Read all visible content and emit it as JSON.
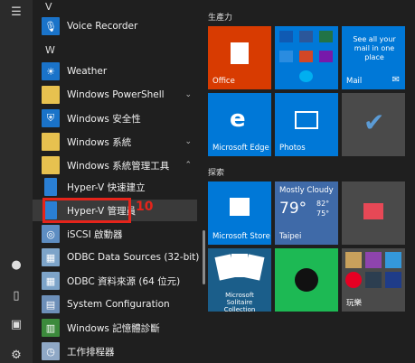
{
  "headers": {
    "v": "V",
    "w": "W"
  },
  "apps": [
    {
      "label": "Voice Recorder",
      "icon": "microphone-icon",
      "color": "#1a73c9"
    },
    {
      "label": "Weather",
      "icon": "sun-icon",
      "color": "#1a73c9"
    },
    {
      "label": "Windows PowerShell",
      "icon": "folder-icon",
      "color": "#e7c14f",
      "chevron": "⌄"
    },
    {
      "label": "Windows 安全性",
      "icon": "shield-icon",
      "color": "#1a73c9"
    },
    {
      "label": "Windows 系統",
      "icon": "folder-icon",
      "color": "#e7c14f",
      "chevron": "⌄"
    },
    {
      "label": "Windows 系統管理工具",
      "icon": "folder-icon",
      "color": "#e7c14f",
      "chevron": "⌃"
    },
    {
      "label": "Hyper-V 快速建立",
      "icon": "hyperv-icon",
      "color": "transparent"
    },
    {
      "label": "Hyper-V 管理員",
      "icon": "hyperv-icon",
      "color": "transparent"
    },
    {
      "label": "iSCSI 啟動器",
      "icon": "iscsi-icon",
      "color": "transparent"
    },
    {
      "label": "ODBC Data Sources (32-bit)",
      "icon": "odbc-icon",
      "color": "transparent"
    },
    {
      "label": "ODBC 資料來源 (64 位元)",
      "icon": "odbc-icon",
      "color": "transparent"
    },
    {
      "label": "System Configuration",
      "icon": "sysconfig-icon",
      "color": "transparent"
    },
    {
      "label": "Windows 記憶體診斷",
      "icon": "memory-diagnostic-icon",
      "color": "transparent"
    },
    {
      "label": "工作排程器",
      "icon": "task-scheduler-icon",
      "color": "transparent"
    }
  ],
  "annotation": "10",
  "groups": {
    "productivity": "生產力",
    "explore": "探索"
  },
  "tiles": {
    "office": "Office",
    "mail_text": "See all your mail in one place",
    "mail": "Mail",
    "edge": "Microsoft Edge",
    "photos": "Photos",
    "store": "Microsoft Store",
    "weather_cond": "Mostly Cloudy",
    "weather_temp": "79°",
    "weather_hi": "82°",
    "weather_lo": "75°",
    "weather_city": "Taipei",
    "solitaire": "Microsoft Solitaire Collection",
    "play": "玩樂"
  },
  "colors": {
    "accent": "#0078d7",
    "office": "#d83b01",
    "highlight": "#e5241b",
    "spotify": "#1db954"
  }
}
